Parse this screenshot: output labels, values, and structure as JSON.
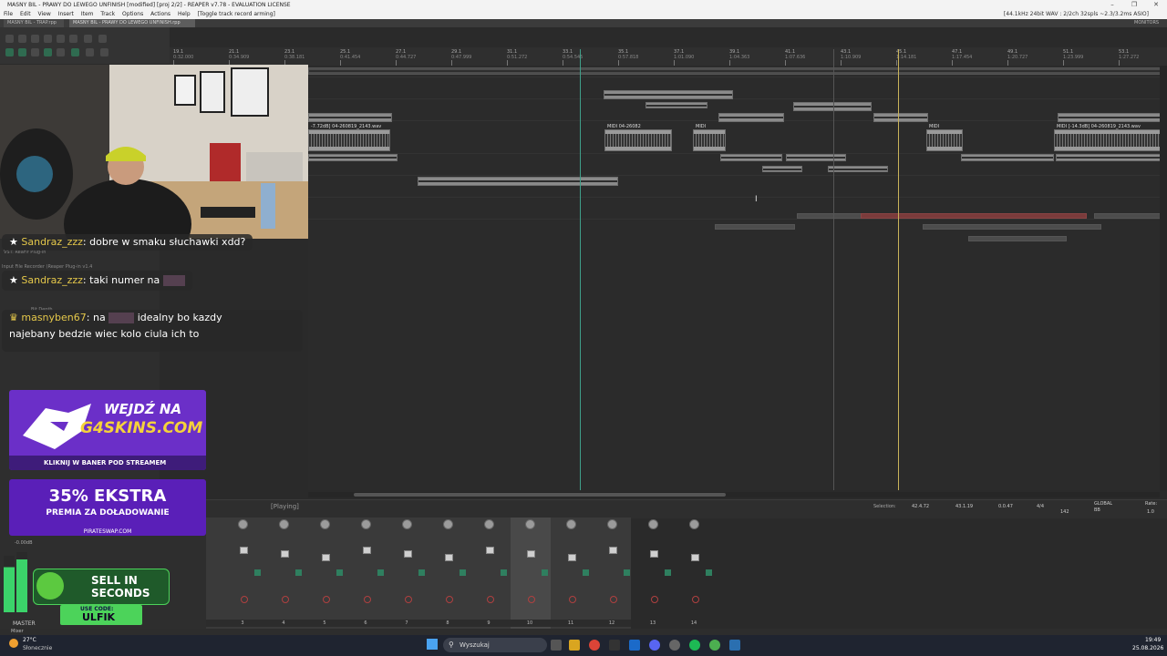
{
  "window": {
    "title": "MASNY BIL - PRAWY DO LEWEGO UNFINISH [modified] [proj 2/2] - REAPER v7.78 - EVALUATION LICENSE",
    "controls": [
      "–",
      "❐",
      "✕"
    ]
  },
  "menubar": {
    "items": [
      "File",
      "Edit",
      "View",
      "Insert",
      "Item",
      "Track",
      "Options",
      "Actions",
      "Help",
      "[Toggle track record arming]"
    ],
    "audio_status": "[44.1kHz 24bit WAV : 2/2ch 32spls ~2.3/3.2ms ASIO]"
  },
  "project_tabs": [
    {
      "label": "MASNY BIL - TRAP.rpp",
      "active": false
    },
    {
      "label": "MASNY BIL - PRAWY DO LEWEGO UNFINISH.rpp",
      "active": true
    }
  ],
  "monitor_label": "MONITORS",
  "ruler": {
    "marks": [
      "19.1",
      "21.1",
      "23.1",
      "25.1",
      "27.1",
      "29.1",
      "31.1",
      "33.1",
      "35.1",
      "37.1",
      "39.1",
      "41.1",
      "43.1",
      "45.1",
      "47.1",
      "49.1",
      "51.1",
      "53.1"
    ],
    "times": [
      "0:32.000",
      "0:34.909",
      "0:38.181",
      "0:41.454",
      "0:44.727",
      "0:47.999",
      "0:51.272",
      "0:54.545",
      "0:57.818",
      "1:01.090",
      "1:04.363",
      "1:07.636",
      "1:10.909",
      "1:14.181",
      "1:17.454",
      "1:20.727",
      "1:23.999",
      "1:27.272"
    ]
  },
  "items": {
    "labels": [
      "-7.72dB] 04-260819_2143.wav",
      "MIDI 04-26082",
      "MIDI",
      "MIDI",
      "MIDI [-14.3dB] 04-260819_2143.wav"
    ]
  },
  "left_panel": {
    "hint1": "VST: ReaFir Plug-in",
    "hint2": "Input File Recorder (Reaper Plug-in v1.4",
    "hint3": "Bit Depth"
  },
  "chat": [
    {
      "user": "Sandraz_zzz",
      "text": "dobre w smaku słuchawki xdd?"
    },
    {
      "user": "Sandraz_zzz",
      "text": "taki numer na"
    },
    {
      "user": "masnyben67",
      "text": "na",
      "text2": "idealny bo kazdy",
      "text3": "najebany bedzie wiec kolo ciula ich to"
    }
  ],
  "ads": {
    "ad1_line1": "WEJDŹ NA",
    "ad1_line2": "G4SKINS.COM",
    "ad1_sub": "KLIKNIJ W BANER POD STREAMEM",
    "ad2_line1": "35% EKSTRA",
    "ad2_line2": "PREMIA ZA DOŁADOWANIE",
    "ad2_sub": "PIRATESWAP.COM",
    "ad3_line1": "SELL IN",
    "ad3_line2": "SECONDS",
    "ad3_code_label": "USE CODE:",
    "ad3_code": "ULFIK"
  },
  "transport": {
    "state": "[Playing]",
    "selection_label": "Selection:",
    "sel_start": "42.4.72",
    "sel_end": "43.1.19",
    "sel_len": "0.0.47",
    "timesig": "4/4",
    "bpm": "142",
    "rate_label": "Rate:",
    "rate": "1.0",
    "global_label": "GLOBAL",
    "global_val": "BB"
  },
  "mixer": {
    "master_label": "MASTER",
    "master_db": "-0.00dB",
    "channels": [
      "3",
      "4",
      "5",
      "6",
      "7",
      "8",
      "9",
      "10",
      "11",
      "12",
      "13",
      "14"
    ],
    "mixer_tab": "Mixer"
  },
  "taskbar": {
    "weather_temp": "27°C",
    "weather_desc": "Słonecznie",
    "search_placeholder": "Wyszukaj",
    "time": "19:49",
    "date": "25.08.2026"
  }
}
